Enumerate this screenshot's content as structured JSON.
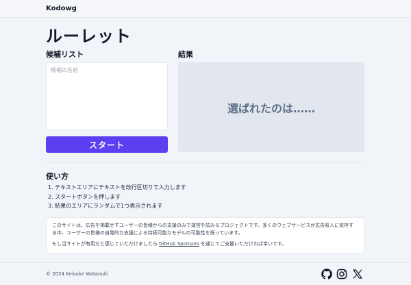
{
  "header": {
    "brand": "Kodowg"
  },
  "page": {
    "title": "ルーレット"
  },
  "candidates": {
    "label": "候補リスト",
    "placeholder": "候補の名前",
    "value": ""
  },
  "start_button": {
    "label": "スタート"
  },
  "result": {
    "label": "結果",
    "text": "選ばれたのは……"
  },
  "howto": {
    "title": "使い方",
    "steps": [
      "1. テキストエリアにテキストを改行区切りで入力します",
      "2. スタートボタンを押します",
      "3. 結果のエリアにランダムで1つ表示されます"
    ]
  },
  "notice": {
    "paragraph1": "このサイトは、広告を掲載せずユーザーの皆様からの支援のみで運営を試みるプロジェクトです。多くのウェブサービスが広告収入に依存する中、ユーザーの皆様の自発的な支援による持続可能なモデルの可能性を探っています。",
    "paragraph2_before": "もし当サイトが有用だと感じていただけましたら ",
    "paragraph2_link": "GitHub Sponsors",
    "paragraph2_after": " を通じてご支援いただければ幸いです。"
  },
  "footer": {
    "copyright": "© 2024 Keisuke Watanuki",
    "icons": [
      "github-icon",
      "instagram-icon",
      "x-icon"
    ]
  },
  "colors": {
    "accent": "#5b3ff0",
    "result_bg": "#e2e7ef",
    "result_text": "#5f6f88",
    "page_bg": "#f1f4f8"
  }
}
